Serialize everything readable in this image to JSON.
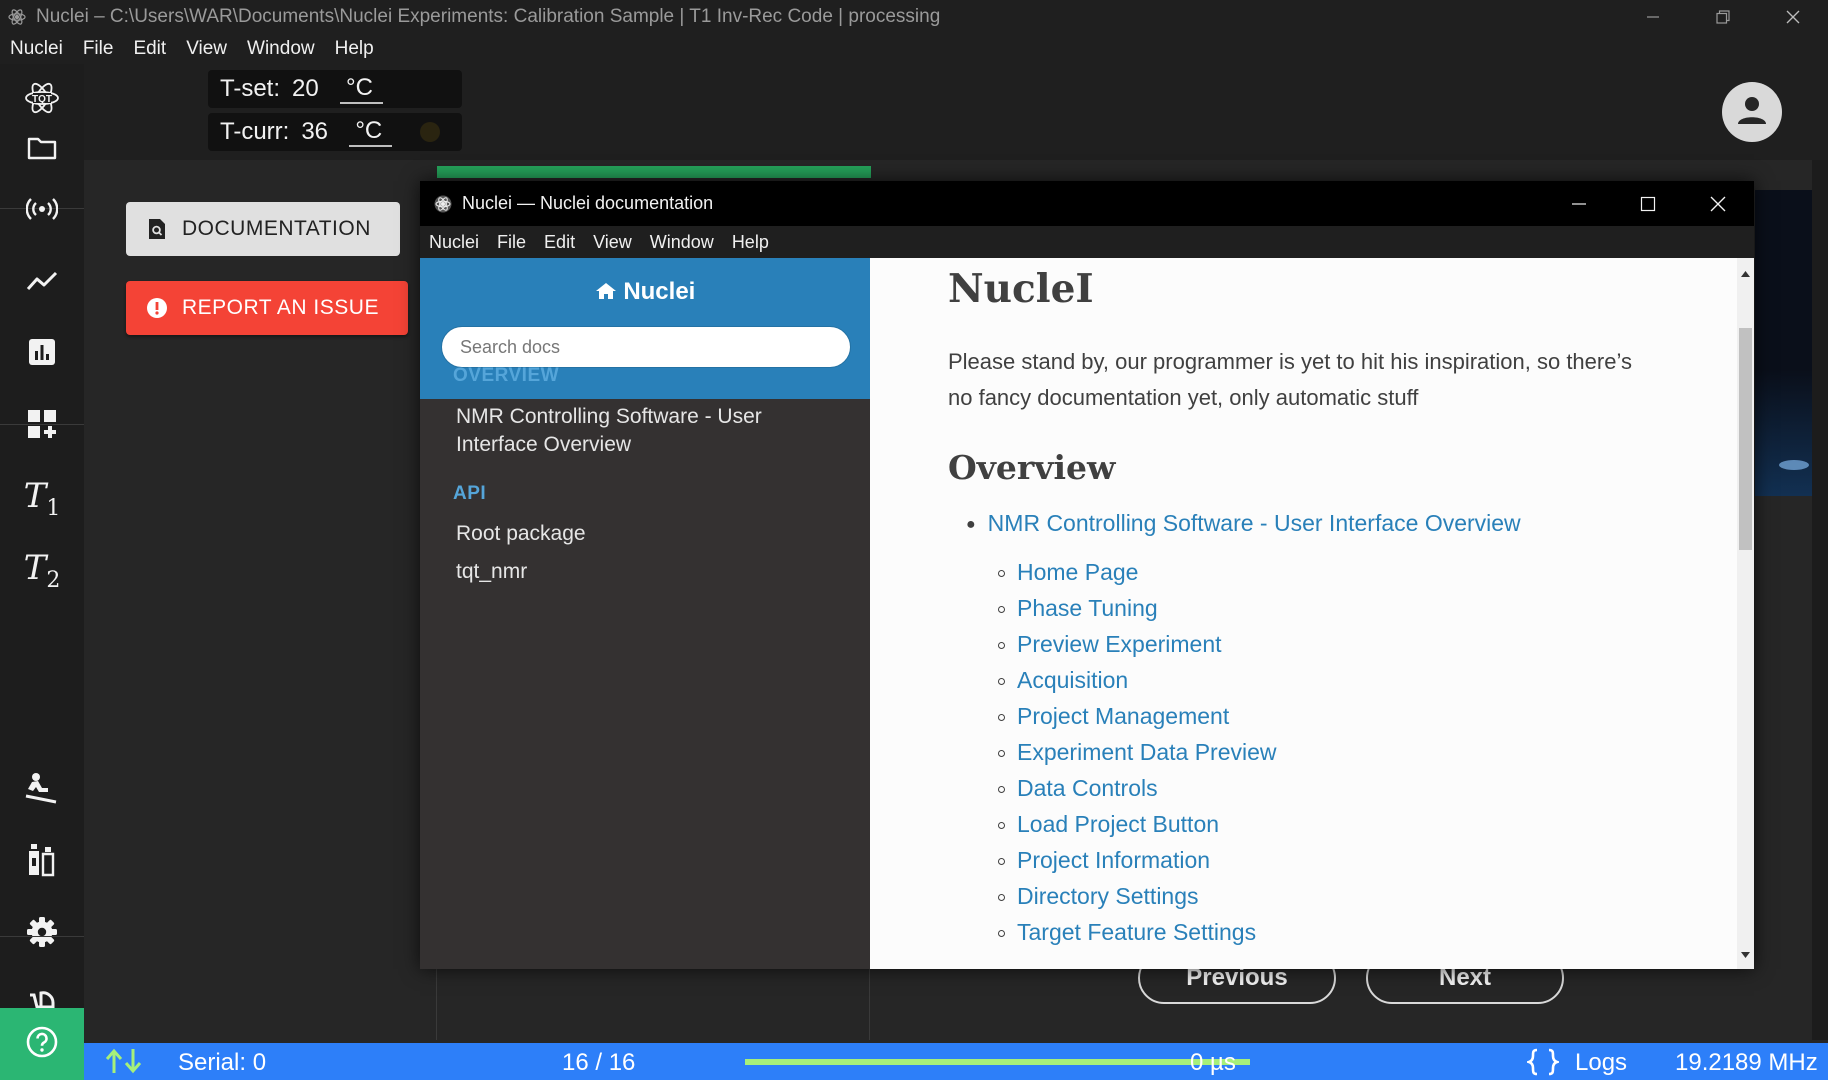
{
  "app": {
    "title": "Nuclei – C:\\Users\\WAR\\Documents\\Nuclei Experiments: Calibration Sample | T1 Inv-Rec Code | processing",
    "menu": [
      "Nuclei",
      "File",
      "Edit",
      "View",
      "Window",
      "Help"
    ]
  },
  "header": {
    "tset_label": "T-set:",
    "tset_value": "20",
    "tcurr_label": "T-curr:",
    "tcurr_value": "36",
    "unit": "°C"
  },
  "rail": {
    "icons": [
      "tqt-logo-icon",
      "folder-icon",
      "broadcast-icon",
      "line-chart-icon",
      "bar-chart-icon",
      "add-dashboard-icon",
      "t1-icon",
      "t2-icon",
      "sledding-icon",
      "bottles-icon",
      "gear-icon",
      "stroller-icon",
      "help-icon"
    ],
    "t1": "T",
    "t1_sub": "1",
    "t2": "T",
    "t2_sub": "2"
  },
  "actions": {
    "documentation_label": "DOCUMENTATION",
    "report_label": "REPORT AN ISSUE"
  },
  "nav": {
    "previous_label": "Previous",
    "next_label": "Next"
  },
  "status": {
    "serial": "Serial: 0",
    "progress_text": "16 / 16",
    "progress_fraction": 1.0,
    "time": "0 µs",
    "logs_label": "Logs",
    "frequency": "19.2189 MHz"
  },
  "doc_window": {
    "title": "Nuclei — Nuclei documentation",
    "menu": [
      "Nuclei",
      "File",
      "Edit",
      "View",
      "Window",
      "Help"
    ],
    "sidebar": {
      "home_label": "Nuclei",
      "search_placeholder": "Search docs",
      "section_overview": "OVERVIEW",
      "overview_link": "NMR Controlling Software - User Interface Overview",
      "section_api": "API",
      "api_links": [
        "Root package",
        "tqt_nmr"
      ]
    },
    "content": {
      "heading": "NucleI",
      "paragraph": "Please stand by, our programmer is yet to hit his inspiration, so there’s no fancy documentation yet, only automatic stuff",
      "overview_heading": "Overview",
      "toc_top": "NMR Controlling Software - User Interface Overview",
      "toc_items": [
        "Home Page",
        "Phase Tuning",
        "Preview Experiment",
        "Acquisition",
        "Project Management",
        "Experiment Data Preview",
        "Data Controls",
        "Load Project Button",
        "Project Information",
        "Directory Settings",
        "Target Feature Settings"
      ]
    }
  },
  "colors": {
    "accent_blue": "#2980b9",
    "status_blue": "#2d7ff9",
    "danger_red": "#f44336",
    "help_green": "#2bb673",
    "progress_green": "#a6f07a"
  }
}
